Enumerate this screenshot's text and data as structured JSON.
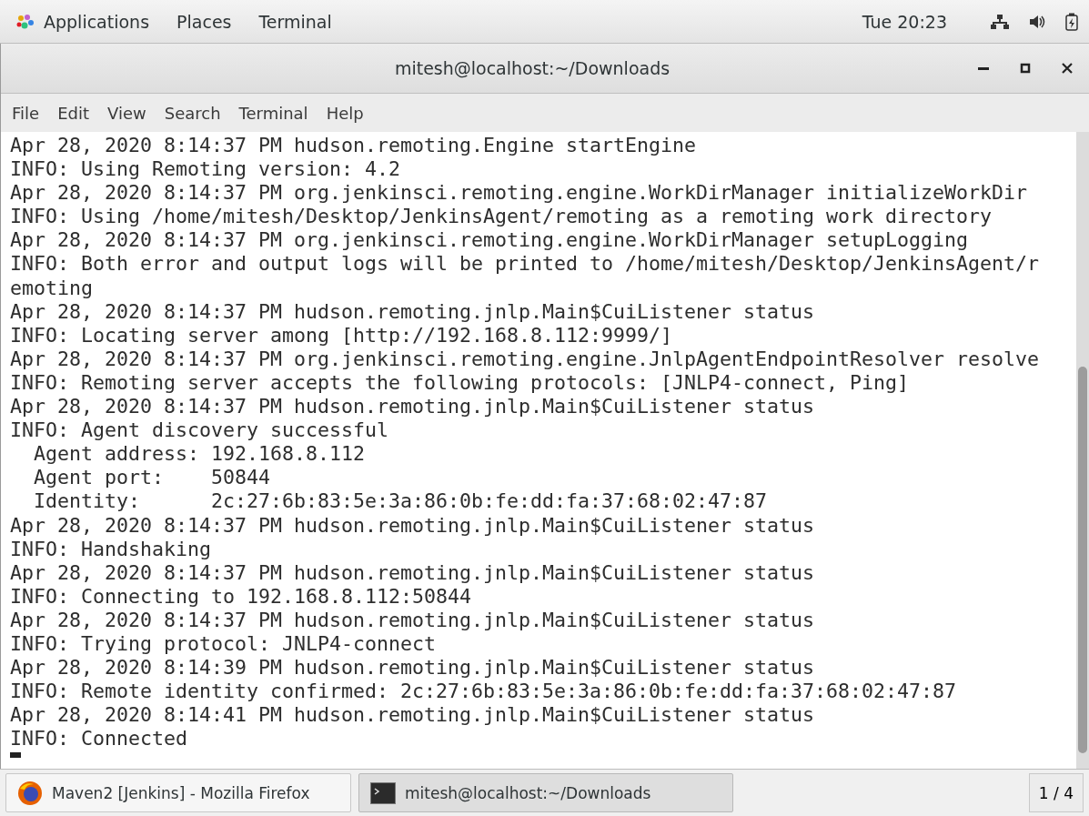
{
  "top_bar": {
    "menus": [
      "Applications",
      "Places",
      "Terminal"
    ],
    "clock": "Tue 20:23"
  },
  "window": {
    "title": "mitesh@localhost:~/Downloads"
  },
  "menu_bar": [
    "File",
    "Edit",
    "View",
    "Search",
    "Terminal",
    "Help"
  ],
  "terminal": {
    "lines": [
      "Apr 28, 2020 8:14:37 PM hudson.remoting.Engine startEngine",
      "INFO: Using Remoting version: 4.2",
      "Apr 28, 2020 8:14:37 PM org.jenkinsci.remoting.engine.WorkDirManager initializeWorkDir",
      "INFO: Using /home/mitesh/Desktop/JenkinsAgent/remoting as a remoting work directory",
      "Apr 28, 2020 8:14:37 PM org.jenkinsci.remoting.engine.WorkDirManager setupLogging",
      "INFO: Both error and output logs will be printed to /home/mitesh/Desktop/JenkinsAgent/r",
      "emoting",
      "Apr 28, 2020 8:14:37 PM hudson.remoting.jnlp.Main$CuiListener status",
      "INFO: Locating server among [http://192.168.8.112:9999/]",
      "Apr 28, 2020 8:14:37 PM org.jenkinsci.remoting.engine.JnlpAgentEndpointResolver resolve",
      "INFO: Remoting server accepts the following protocols: [JNLP4-connect, Ping]",
      "Apr 28, 2020 8:14:37 PM hudson.remoting.jnlp.Main$CuiListener status",
      "INFO: Agent discovery successful",
      "  Agent address: 192.168.8.112",
      "  Agent port:    50844",
      "  Identity:      2c:27:6b:83:5e:3a:86:0b:fe:dd:fa:37:68:02:47:87",
      "Apr 28, 2020 8:14:37 PM hudson.remoting.jnlp.Main$CuiListener status",
      "INFO: Handshaking",
      "Apr 28, 2020 8:14:37 PM hudson.remoting.jnlp.Main$CuiListener status",
      "INFO: Connecting to 192.168.8.112:50844",
      "Apr 28, 2020 8:14:37 PM hudson.remoting.jnlp.Main$CuiListener status",
      "INFO: Trying protocol: JNLP4-connect",
      "Apr 28, 2020 8:14:39 PM hudson.remoting.jnlp.Main$CuiListener status",
      "INFO: Remote identity confirmed: 2c:27:6b:83:5e:3a:86:0b:fe:dd:fa:37:68:02:47:87",
      "Apr 28, 2020 8:14:41 PM hudson.remoting.jnlp.Main$CuiListener status",
      "INFO: Connected"
    ]
  },
  "taskbar": {
    "items": [
      {
        "kind": "browser",
        "label": "Maven2 [Jenkins] - Mozilla Firefox",
        "selected": false
      },
      {
        "kind": "terminal",
        "label": "mitesh@localhost:~/Downloads",
        "selected": true
      }
    ],
    "workspace": "1 / 4"
  }
}
